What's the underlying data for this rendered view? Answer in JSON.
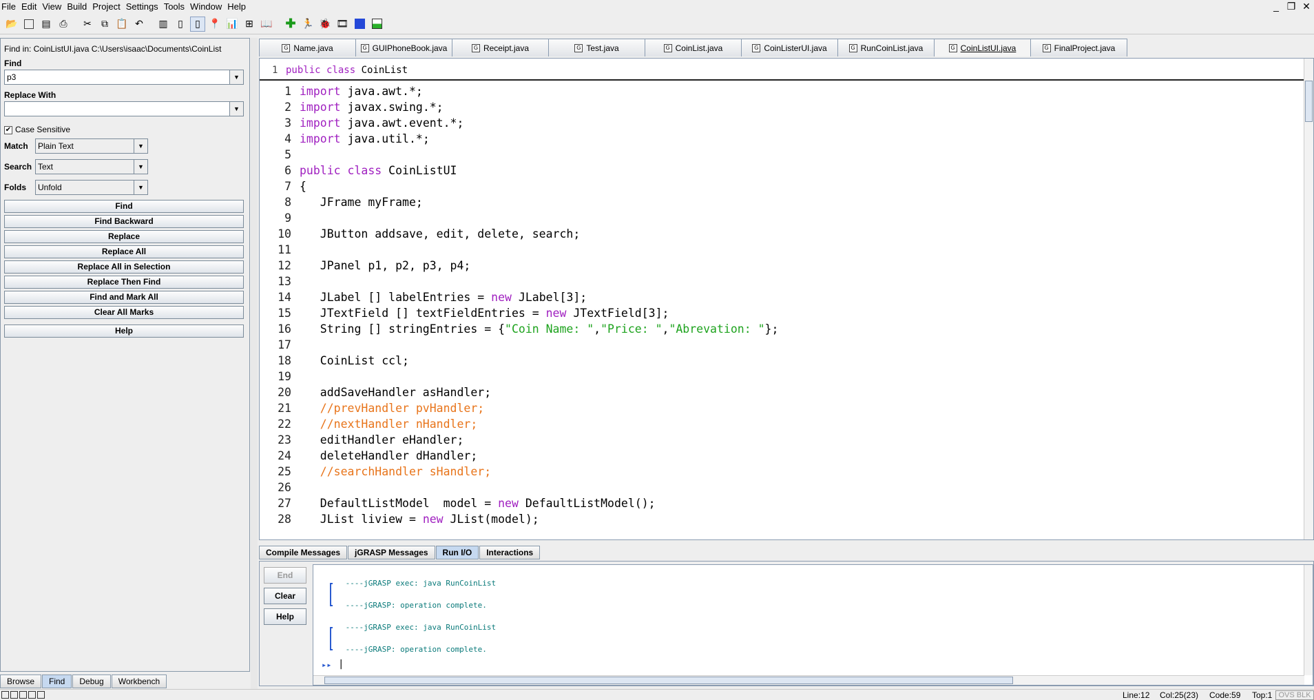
{
  "menubar": {
    "items": [
      "File",
      "Edit",
      "View",
      "Build",
      "Project",
      "Settings",
      "Tools",
      "Window",
      "Help"
    ],
    "window_controls": [
      "_",
      "❐",
      "✕"
    ]
  },
  "find_panel": {
    "find_in_label": "Find in: CoinListUI.java  C:\\Users\\isaac\\Documents\\CoinList",
    "find_label": "Find",
    "find_value": "p3",
    "replace_label": "Replace With",
    "replace_value": "",
    "case_sensitive_label": "Case Sensitive",
    "case_sensitive_checked": true,
    "match_label": "Match",
    "match_value": "Plain Text",
    "search_label": "Search",
    "search_value": "Text",
    "folds_label": "Folds",
    "folds_value": "Unfold",
    "buttons": [
      "Find",
      "Find Backward",
      "Replace",
      "Replace All",
      "Replace All in Selection",
      "Replace Then Find",
      "Find and Mark All",
      "Clear All Marks"
    ],
    "help_label": "Help"
  },
  "left_tabs": [
    "Browse",
    "Find",
    "Debug",
    "Workbench"
  ],
  "editor_tabs": [
    "Name.java",
    "GUIPhoneBook.java",
    "Receipt.java",
    "Test.java",
    "CoinList.java",
    "CoinListerUI.java",
    "RunCoinList.java",
    "CoinListUI.java",
    "FinalProject.java"
  ],
  "editor_active_tab": "CoinListUI.java",
  "structure_line": {
    "number": "1",
    "keyword": "public class",
    "name": "CoinList"
  },
  "code_lines": [
    "1",
    "import java.awt.*;",
    "2",
    "import javax.swing.*;",
    "3",
    "import java.awt.event.*;",
    "4",
    "import java.util.*;",
    "5",
    "",
    "6",
    "public class CoinListUI",
    "7",
    "{",
    "8",
    "   JFrame myFrame;",
    "9",
    "",
    "10",
    "   JButton addsave, edit, delete, search;",
    "11",
    "",
    "12",
    "   JPanel p1, p2, p3, p4;",
    "13",
    "",
    "14",
    "   JLabel [] labelEntries = new JLabel[3];",
    "15",
    "   JTextField [] textFieldEntries = new JTextField[3];",
    "16",
    "   String [] stringEntries = {\"Coin Name: \",\"Price: \",\"Abrevation: \"};",
    "17",
    "",
    "18",
    "   CoinList ccl;",
    "19",
    "",
    "20",
    "   addSaveHandler asHandler;",
    "21",
    "   //prevHandler pvHandler;",
    "22",
    "   //nextHandler nHandler;",
    "23",
    "   editHandler eHandler;",
    "24",
    "   deleteHandler dHandler;",
    "25",
    "   //searchHandler sHandler;",
    "26",
    "",
    "27",
    "   DefaultListModel  model = new DefaultListModel();",
    "28",
    "   JList liview = new JList(model);"
  ],
  "bottom_tabs": [
    "Compile Messages",
    "jGRASP Messages",
    "Run I/O",
    "Interactions"
  ],
  "bottom_active_tab": "Run I/O",
  "run_io": {
    "buttons": [
      "End",
      "Clear",
      "Help"
    ],
    "console_lines": [
      " ----jGRASP exec: java RunCoinList",
      " ----jGRASP: operation complete.",
      " ----jGRASP exec: java RunCoinList",
      " ----jGRASP: operation complete."
    ],
    "prompt": "▸▸",
    "caret": "|"
  },
  "status_bar": {
    "line": "Line:12",
    "col": "Col:25(23)",
    "code": "Code:59",
    "top": "Top:1",
    "ovs": "OVS BLK"
  },
  "colors": {
    "keyword": "#a020c0",
    "string": "#1ea31e",
    "comment": "#e8741a",
    "console": "#0a7a7a",
    "active_tab": "#c6d9f0"
  }
}
